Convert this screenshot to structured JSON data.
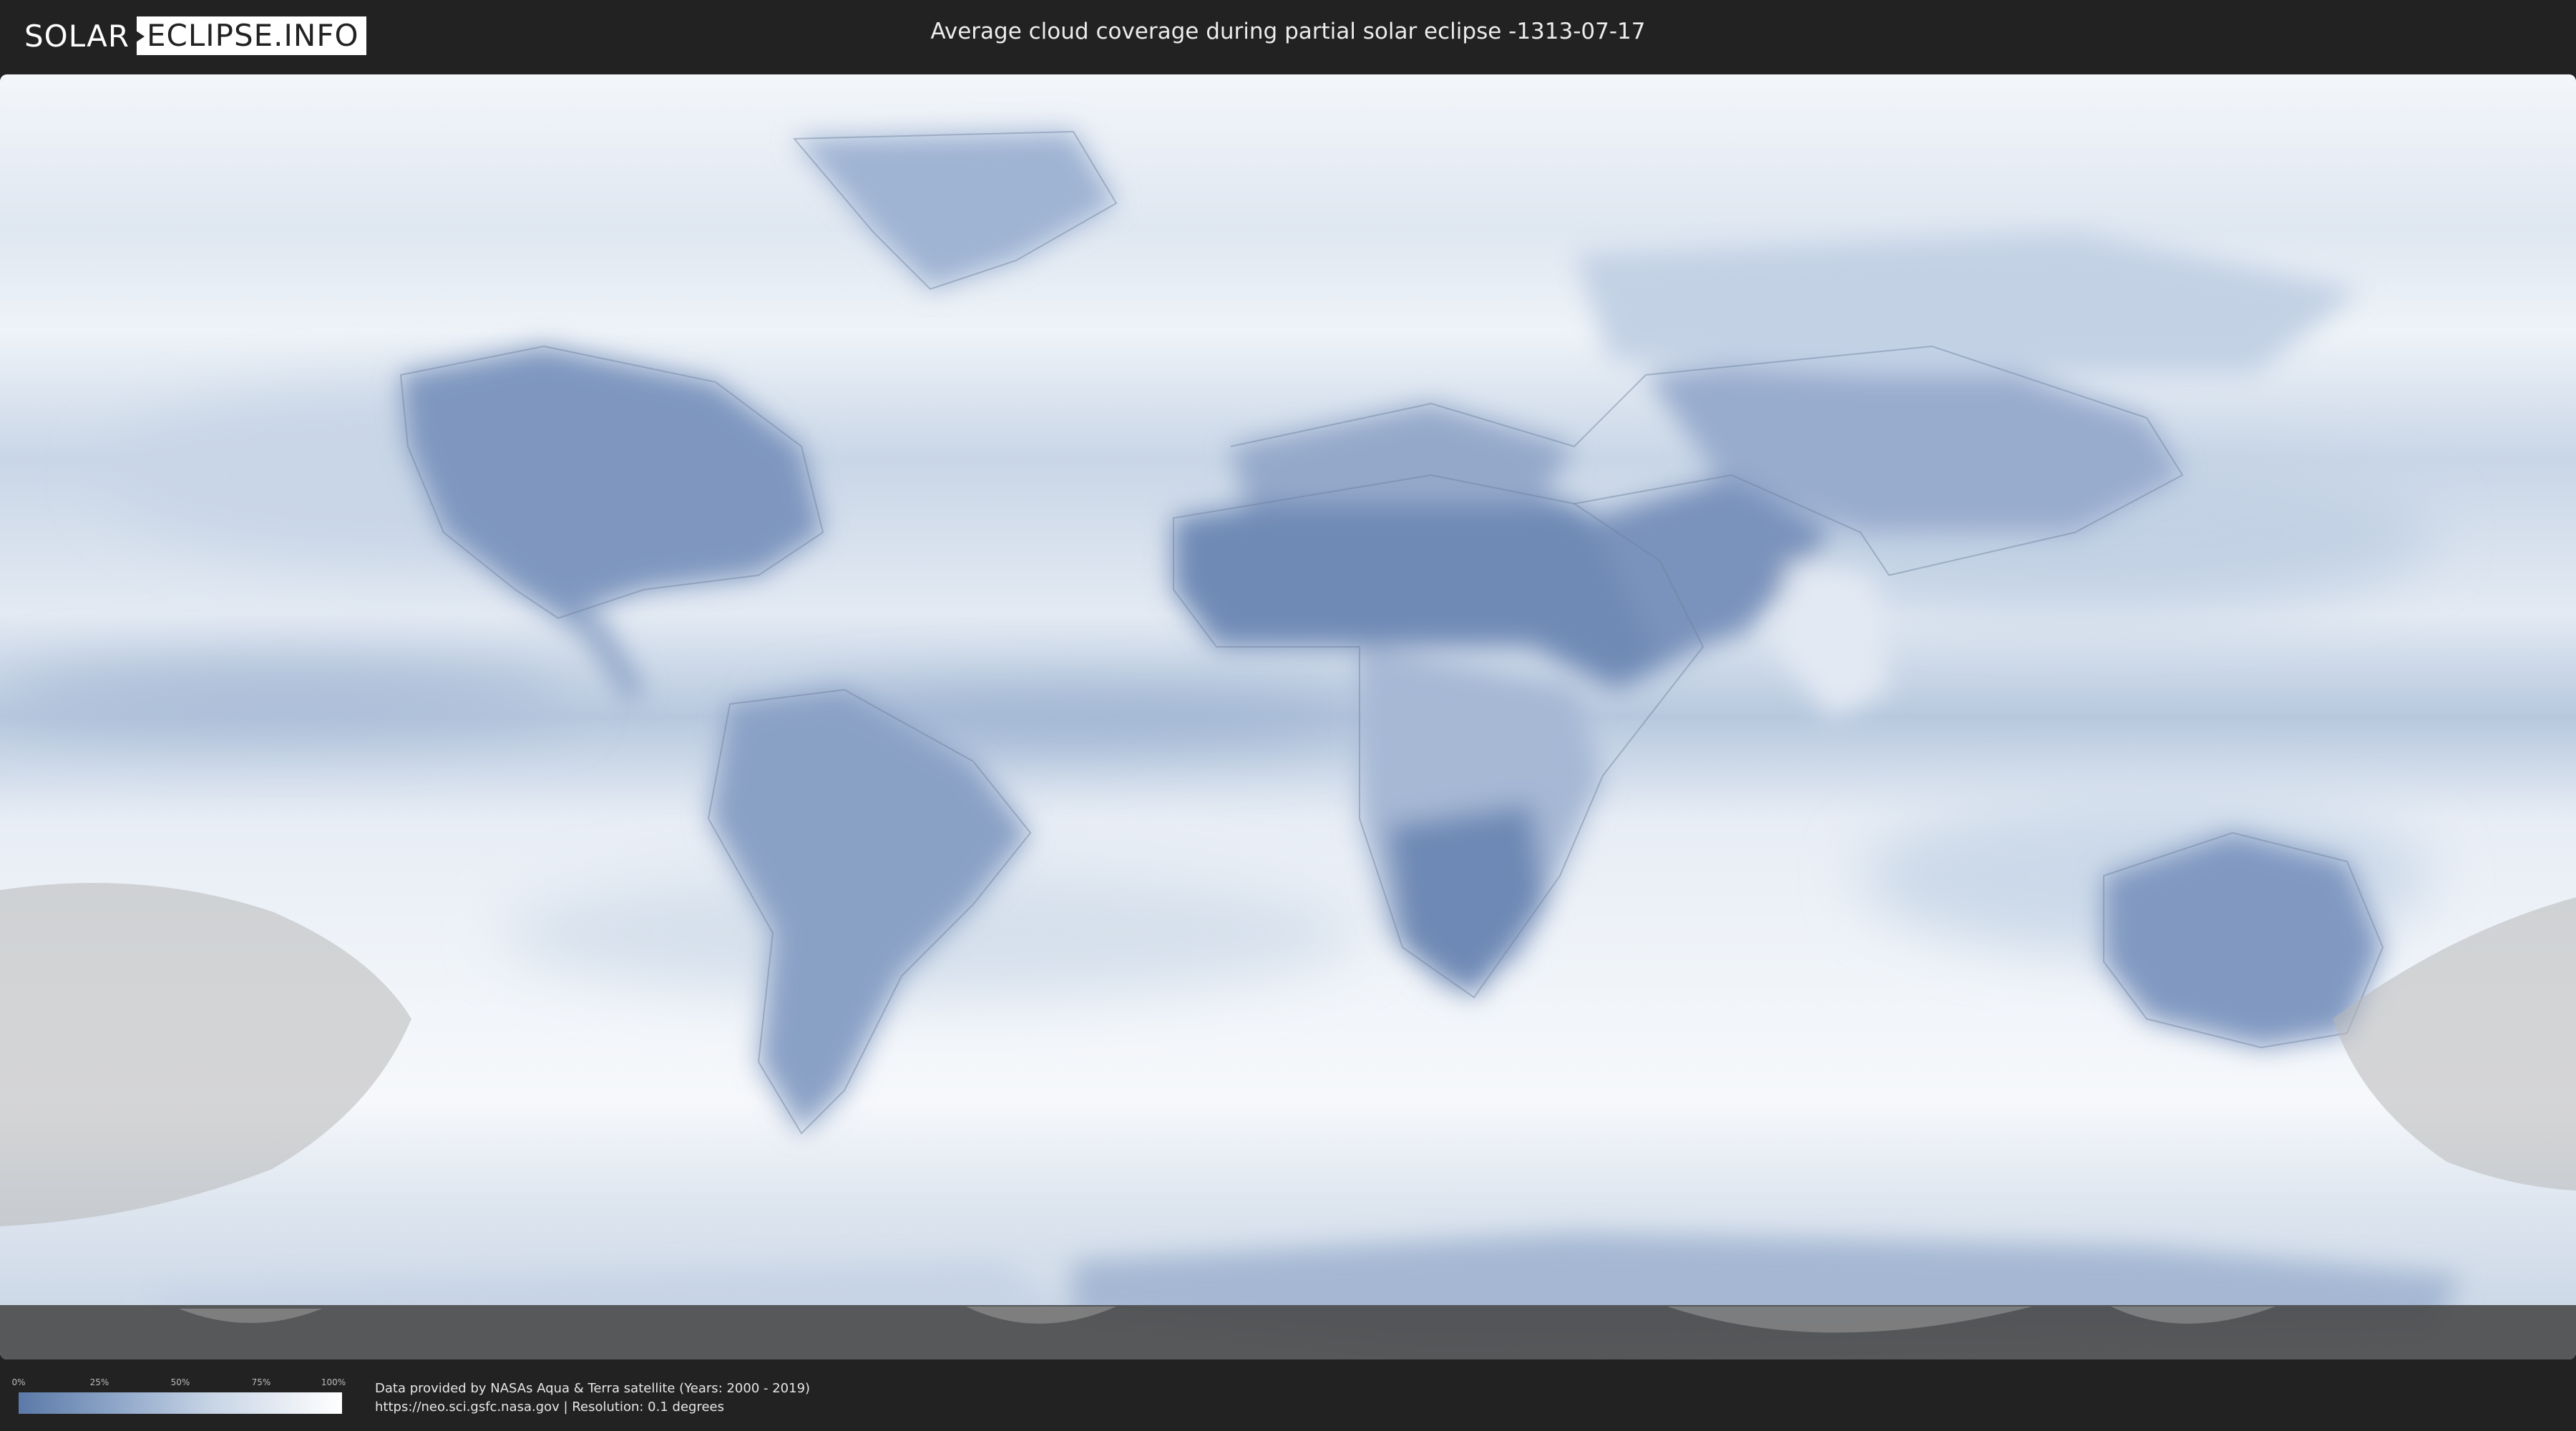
{
  "header": {
    "logo_solar": "SOLAR",
    "logo_eclipse": "ECLIPSE.INFO",
    "title": "Average cloud coverage during partial solar eclipse -1313-07-17"
  },
  "legend": {
    "ticks": [
      "0%",
      "25%",
      "50%",
      "75%",
      "100%"
    ],
    "ticks_values": [
      0,
      25,
      50,
      75,
      100
    ],
    "color_low": "#5b79a8",
    "color_high": "#ffffff"
  },
  "attribution": {
    "line1": "Data provided by NASAs Aqua & Terra satellite (Years: 2000 - 2019)",
    "line2": "https://neo.sci.gsfc.nasa.gov | Resolution: 0.1 degrees"
  },
  "colors": {
    "background": "#222222",
    "clear_sky": "#5b79a8",
    "cloudy": "#ffffff",
    "eclipse_overlay": "#b8b8b8",
    "polar_night": "#4a4a4a"
  }
}
